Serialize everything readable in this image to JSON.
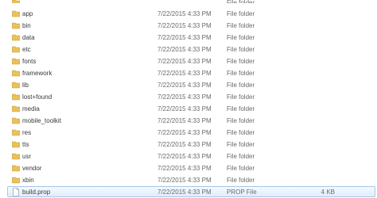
{
  "files": [
    {
      "name": "",
      "date": "",
      "type": "File folder",
      "size": "",
      "icon": "folder-icon"
    },
    {
      "name": "app",
      "date": "7/22/2015 4:33 PM",
      "type": "File folder",
      "size": "",
      "icon": "folder-icon"
    },
    {
      "name": "bin",
      "date": "7/22/2015 4:33 PM",
      "type": "File folder",
      "size": "",
      "icon": "folder-icon"
    },
    {
      "name": "data",
      "date": "7/22/2015 4:33 PM",
      "type": "File folder",
      "size": "",
      "icon": "folder-icon"
    },
    {
      "name": "etc",
      "date": "7/22/2015 4:33 PM",
      "type": "File folder",
      "size": "",
      "icon": "folder-icon"
    },
    {
      "name": "fonts",
      "date": "7/22/2015 4:33 PM",
      "type": "File folder",
      "size": "",
      "icon": "folder-icon"
    },
    {
      "name": "framework",
      "date": "7/22/2015 4:33 PM",
      "type": "File folder",
      "size": "",
      "icon": "folder-icon"
    },
    {
      "name": "lib",
      "date": "7/22/2015 4:33 PM",
      "type": "File folder",
      "size": "",
      "icon": "folder-icon"
    },
    {
      "name": "lost+found",
      "date": "7/22/2015 4:33 PM",
      "type": "File folder",
      "size": "",
      "icon": "folder-icon"
    },
    {
      "name": "media",
      "date": "7/22/2015 4:33 PM",
      "type": "File folder",
      "size": "",
      "icon": "folder-icon"
    },
    {
      "name": "mobile_toolkit",
      "date": "7/22/2015 4:33 PM",
      "type": "File folder",
      "size": "",
      "icon": "folder-icon"
    },
    {
      "name": "res",
      "date": "7/22/2015 4:33 PM",
      "type": "File folder",
      "size": "",
      "icon": "folder-icon"
    },
    {
      "name": "tts",
      "date": "7/22/2015 4:33 PM",
      "type": "File folder",
      "size": "",
      "icon": "folder-icon"
    },
    {
      "name": "usr",
      "date": "7/22/2015 4:33 PM",
      "type": "File folder",
      "size": "",
      "icon": "folder-icon"
    },
    {
      "name": "vendor",
      "date": "7/22/2015 4:33 PM",
      "type": "File folder",
      "size": "",
      "icon": "folder-icon"
    },
    {
      "name": "xbin",
      "date": "7/22/2015 4:33 PM",
      "type": "File folder",
      "size": "",
      "icon": "folder-icon"
    },
    {
      "name": "build.prop",
      "date": "7/22/2015 4:33 PM",
      "type": "PROP File",
      "size": "4 KB",
      "icon": "file-icon"
    }
  ],
  "colors": {
    "folder": "#e8c25a",
    "folder_dark": "#c99a2c",
    "selection_fill": "#e2eefb",
    "selection_border": "#a9c6ea"
  }
}
